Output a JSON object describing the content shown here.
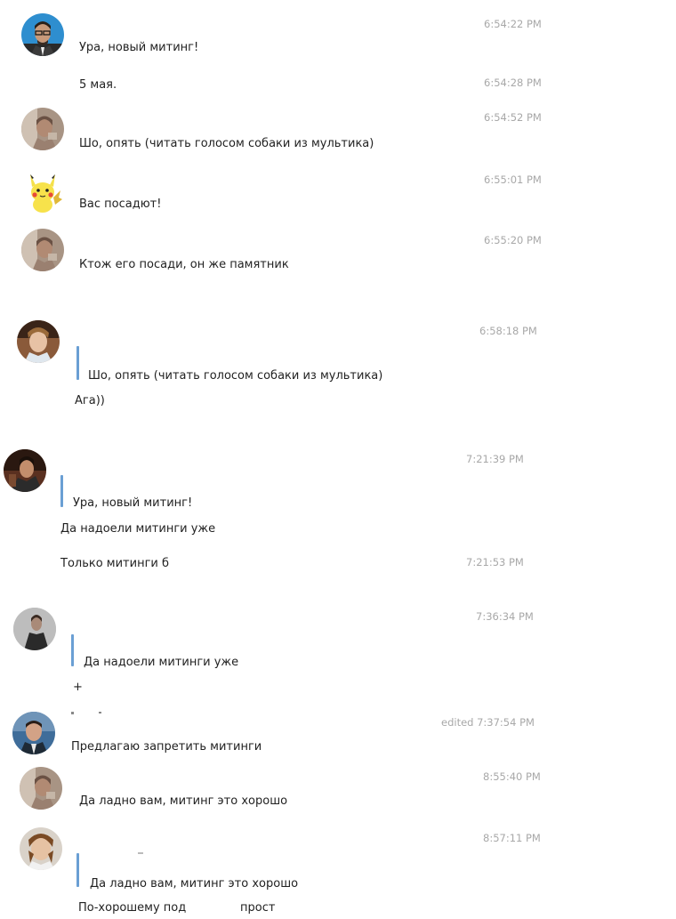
{
  "messages": [
    {
      "text": "Ура, новый митинг!",
      "time": "6:54:22 PM"
    },
    {
      "text": "5 мая.",
      "time": "6:54:28 PM"
    },
    {
      "text": "Шо, опять (читать голосом собаки из мультика)",
      "time": "6:54:52 PM"
    },
    {
      "text": "Вас посадют!",
      "time": "6:55:01 PM"
    },
    {
      "text": "Ктож его посади, он же памятник",
      "time": "6:55:20 PM"
    },
    {
      "quote": "Шо, опять (читать голосом собаки из мультика)",
      "text": "Ага))",
      "time": "6:58:18 PM"
    },
    {
      "quote": "Ура, новый митинг!",
      "text": "Да надоели митинги уже",
      "time": "7:21:39 PM"
    },
    {
      "text": "Только митинги б",
      "time": "7:21:53 PM"
    },
    {
      "quote": "Да надоели митинги уже",
      "text": "+",
      "time": "7:36:34 PM"
    },
    {
      "text": "Предлагаю запретить митинги",
      "time": "edited 7:37:54 PM"
    },
    {
      "text": "Да ладно вам, митинг это хорошо",
      "time": "8:55:40 PM"
    },
    {
      "quote": "Да ладно вам, митинг это хорошо",
      "text": "По-хорошему под",
      "text_tail": "прост",
      "time": "8:57:11 PM"
    }
  ],
  "colors": {
    "timestamp": "#a8a8a8",
    "quote_bar": "#6a9fd4",
    "text": "#222222"
  },
  "icons": {
    "avatar_1": "user-avatar-man-glasses",
    "avatar_2": "user-avatar-photo",
    "avatar_3": "user-avatar-pikachu",
    "avatar_4": "user-avatar-photo",
    "avatar_5": "user-avatar-young-man",
    "avatar_6": "user-avatar-dark-portrait",
    "avatar_7": "user-avatar-dark-figure",
    "avatar_8": "user-avatar-man-shirt",
    "avatar_9": "user-avatar-photo",
    "avatar_10": "user-avatar-woman"
  }
}
